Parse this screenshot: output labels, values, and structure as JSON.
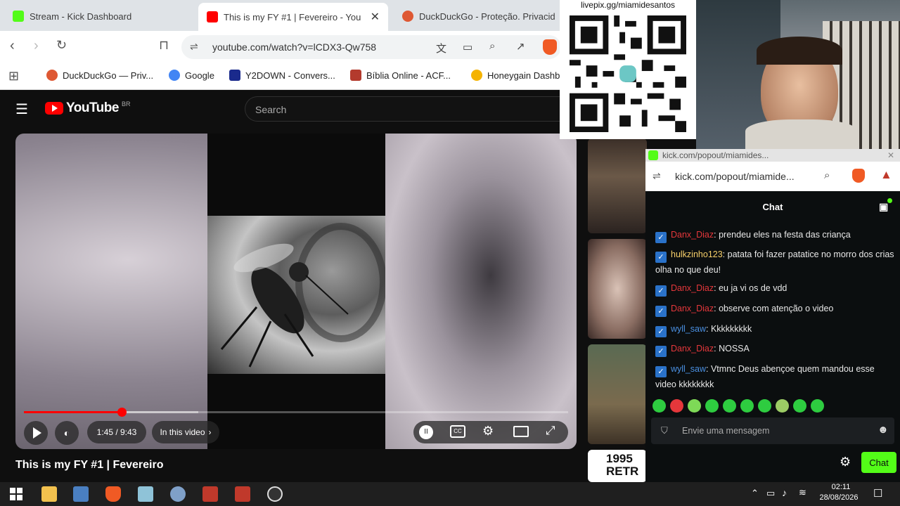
{
  "tabs": [
    {
      "title": "Stream - Kick Dashboard",
      "favicon_color": "#53fc18"
    },
    {
      "title": "This is my FY #1 | Fevereiro - You",
      "favicon_color": "#ff0000"
    },
    {
      "title": "DuckDuckGo - Proteção. Privacid",
      "favicon_color": "#de5833"
    }
  ],
  "toolbar": {
    "url": "youtube.com/watch?v=lCDX3-Qw758"
  },
  "bookmarks": [
    {
      "label": "DuckDuckGo — Priv...",
      "color": "#de5833"
    },
    {
      "label": "Google",
      "color": "#4285f4"
    },
    {
      "label": "Y2DOWN - Convers...",
      "color": "#1a2a8c"
    },
    {
      "label": "Bíblia Online - ACF...",
      "color": "#b33a2d"
    },
    {
      "label": "Honeygain Dashb",
      "color": "#f5b300"
    }
  ],
  "youtube": {
    "logo_text": "YouTube",
    "region": "BR",
    "search_placeholder": "Search",
    "video_title": "This is my FY #1 | Fevereiro",
    "time": "1:45 / 9:43",
    "in_this_video": "In this video",
    "progress": 0.18,
    "buffered": 0.32
  },
  "overlay": {
    "qr_caption": "livepix.gg/miamidesantos"
  },
  "thumbs": [
    {
      "label": ""
    },
    {
      "label": ""
    },
    {
      "label": ""
    },
    {
      "label": "1995 RETR"
    }
  ],
  "kick": {
    "window_title": "kick.com/popout/miamides...",
    "url": "kick.com/popout/miamide...",
    "chat_title": "Chat",
    "messages": [
      {
        "user": "Danx_Diaz",
        "color": "#e5373b",
        "text": "prendeu eles na festa das criança"
      },
      {
        "user": "hulkzinho123",
        "color": "#f7d06a",
        "text": "patata foi fazer patatice no morro dos crias olha no que deu!"
      },
      {
        "user": "Danx_Diaz",
        "color": "#e5373b",
        "text": "eu ja vi os de vdd"
      },
      {
        "user": "Danx_Diaz",
        "color": "#e5373b",
        "text": "observe com atenção o video"
      },
      {
        "user": "wyll_saw",
        "color": "#4a90e2",
        "text": "Kkkkkkkkk"
      },
      {
        "user": "Danx_Diaz",
        "color": "#e5373b",
        "text": "NOSSA"
      },
      {
        "user": "wyll_saw",
        "color": "#4a90e2",
        "text": "Vtmnc Deus abençoe quem mandou esse video kkkkkkkk"
      }
    ],
    "input_placeholder": "Envie uma mensagem",
    "chat_button": "Chat"
  },
  "taskbar": {
    "time": "02:11",
    "date": "28/08/2026"
  }
}
